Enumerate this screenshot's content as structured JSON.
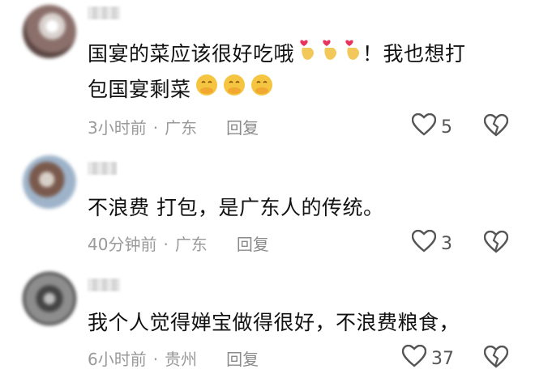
{
  "comments": [
    {
      "username": "",
      "text_line1": "国宴的菜应该很好吃哦",
      "text_mid": "！我也想打",
      "text_line2": "包国宴剩菜",
      "time": "3小时前",
      "separator": "·",
      "location": "广东",
      "reply_label": "回复",
      "likes": "5"
    },
    {
      "username": "",
      "text": "不浪费 打包，是广东人的传统。",
      "time": "40分钟前",
      "separator": "·",
      "location": "广东",
      "reply_label": "回复",
      "likes": "3"
    },
    {
      "username": "",
      "text": "我个人觉得婵宝做得很好，不浪费粮食，",
      "time": "6小时前",
      "separator": "·",
      "location": "贵州",
      "reply_label": "回复",
      "likes": "37"
    }
  ],
  "icons": {
    "like": "heart-outline-icon",
    "dislike": "broken-heart-icon",
    "emoji_a": "finger-heart-emoji",
    "emoji_b": "hand-over-mouth-emoji"
  },
  "colors": {
    "meta": "#9a9a9a",
    "text": "#111111",
    "icon": "#555555"
  }
}
